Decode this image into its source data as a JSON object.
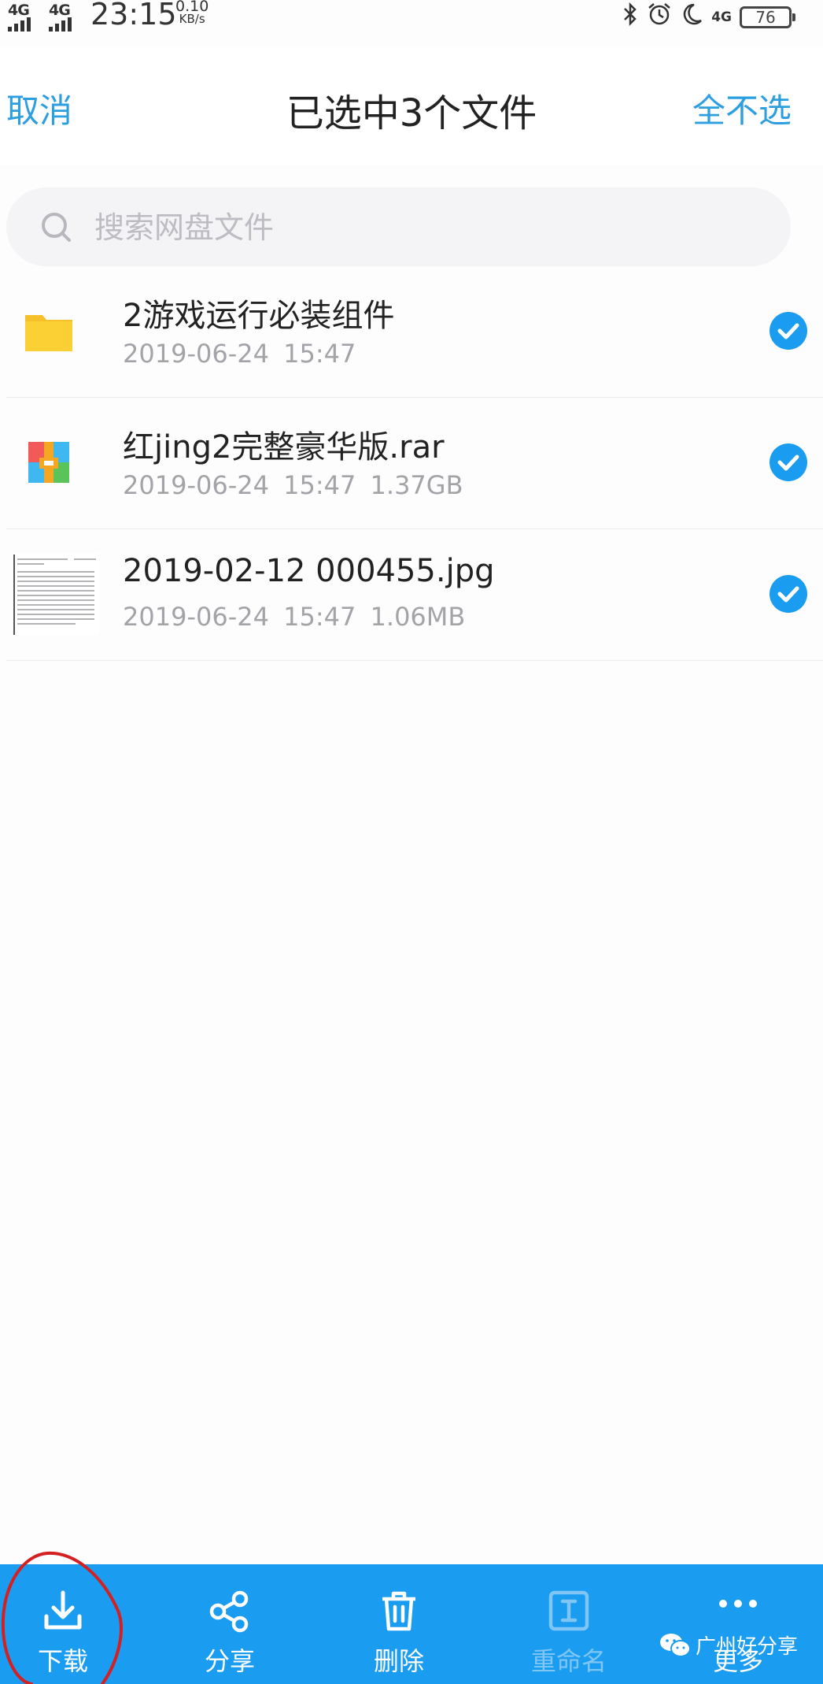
{
  "status_bar": {
    "network1": "4G",
    "network2": "4G",
    "time": "23:15",
    "speed_value": "0.10",
    "speed_unit": "KB/s",
    "network3": "4G",
    "battery": "76"
  },
  "header": {
    "cancel_label": "取消",
    "title": "已选中3个文件",
    "deselect_all_label": "全不选"
  },
  "search": {
    "placeholder": "搜索网盘文件"
  },
  "files": [
    {
      "name": "2游戏运行必装组件",
      "meta": "2019-06-24 15:47",
      "icon": "folder-icon",
      "checked": true
    },
    {
      "name": "红jing2完整豪华版.rar",
      "meta": "2019-06-24 15:47 1.37GB",
      "icon": "rar-archive-icon",
      "checked": true
    },
    {
      "name": "2019-02-12 000455.jpg",
      "meta": "2019-06-24 15:47 1.06MB",
      "icon": "image-thumbnail",
      "checked": true
    }
  ],
  "toolbar": {
    "download_label": "下载",
    "share_label": "分享",
    "delete_label": "删除",
    "rename_label": "重命名",
    "more_label": "更多"
  },
  "watermark": {
    "text": "广州好分享"
  },
  "colors": {
    "accent": "#1a9cf0",
    "header_link": "#2d9ee0",
    "folder": "#fbd035"
  }
}
